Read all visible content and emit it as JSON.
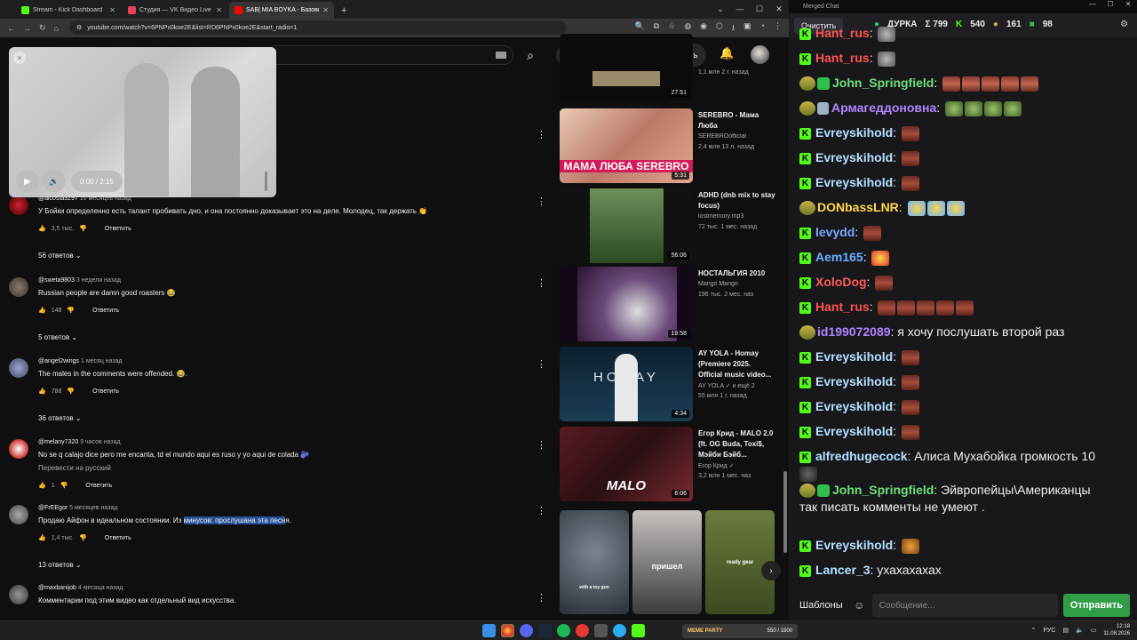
{
  "browser": {
    "tabs": [
      {
        "title": "Stream - Kick Dashboard",
        "color": "#53fc18"
      },
      {
        "title": "Студия — VK Видео Live",
        "color": "#e8415b"
      },
      {
        "title": "SAB| MIA BOYKA - Базовый м",
        "color": "#ff0000"
      }
    ],
    "url": "youtube.com/watch?v=6PNPx0koe2E&list=RD6PNPx0koe2E&start_radio=1",
    "newtab": "+"
  },
  "youtube": {
    "create_label": "Создать",
    "player": {
      "time": "0:00 / 2:15"
    },
    "comments": [
      {
        "author": "@alcosta3297",
        "ago": "10 месяцев назад",
        "text": "У Бойки определенно есть талант пробивать дно, и она постоянно доказывает это на деле. Молодец, так держать 👏",
        "likes": "3,5 тыс.",
        "reply": "Ответить",
        "replies": "56 ответов"
      },
      {
        "author": "@sweta9803",
        "ago": "3 недели назад",
        "text": "Russian people are damn good roasters 😂",
        "likes": "148",
        "reply": "Ответить",
        "replies": "5 ответов"
      },
      {
        "author": "@angel2wings",
        "ago": "1 месяц назад",
        "text": "The males in the comments were offended. 😂.",
        "likes": "788",
        "reply": "Ответить",
        "replies": "36 ответов"
      },
      {
        "author": "@melany7320",
        "ago": "9 часов назад",
        "text": "No se q calajo dice pero me encanta, td el mundo aqui es ruso y yo aqui de colada 🫐",
        "translate": "Перевести на русский",
        "likes": "1",
        "reply": "Ответить"
      },
      {
        "author": "@FrEEgor",
        "ago": "5 месяцев назад",
        "text_a": "Продаю Айфон в идеальном состоянии. Из ",
        "text_b": "минусов: прослушана эта песн",
        "text_c": "я.",
        "likes": "1,4 тыс.",
        "reply": "Ответить",
        "replies": "13 ответов"
      },
      {
        "author": "@maxbanijob",
        "ago": "4 месяца назад",
        "text": "Комментарии под этим видео как отдельный вид искусства."
      }
    ],
    "related": [
      {
        "title": "",
        "channel": "",
        "views": "1,1 млн  2 г. назад",
        "duration": "27:51"
      },
      {
        "title": "SEREBRO - Мама Люба",
        "channel": "SEREBROofficial",
        "views": "2,4 млн  13 л. назад",
        "duration": "5:31",
        "thumb_text": "МАМА ЛЮБА SEREBRO"
      },
      {
        "title": "ADHD (dnb mix to stay focus)",
        "channel": "lostmemory.mp3",
        "views": "72 тыс.  1 мес. назад",
        "duration": "56:06"
      },
      {
        "title": "НОСТАЛЬГИЯ 2010",
        "channel": "Mango Mango",
        "views": "196 тыс.  2 мес. наз",
        "duration": "19:58"
      },
      {
        "title": "AY YOLA - Homay (Premiere 2025. Official music video...",
        "channel": "AY YOLA  ✓ и ещё 2",
        "views": "55 млн  1 г. назад",
        "duration": "4:34",
        "thumb_text": "HOMAY"
      },
      {
        "title": "Егор Крид - MALO 2.0 (ft. OG Buda, Toxi$, Мэйби Бэйб...",
        "channel": "Егор Крид ✓",
        "views": "3,2 млн  1 мес. наз",
        "duration": "6:06",
        "thumb_text": "MALO"
      }
    ],
    "shorts": [
      {
        "caption": "with a toy gun"
      },
      {
        "caption": "пришел"
      },
      {
        "caption": "ready gear"
      }
    ]
  },
  "chat": {
    "window_title": "Merged Chat",
    "clear_label": "Очистить",
    "channel": "ДУРКА",
    "stats": {
      "sigma": "Σ 799",
      "kick": "540",
      "vk": "161",
      "other": "98"
    },
    "messages": [
      {
        "user": "Hant_rus",
        "text": "",
        "color": "#ff5252",
        "src": "kick",
        "emotes": [
          "pot"
        ]
      },
      {
        "user": "Hant_rus",
        "text": "",
        "color": "#ff5252",
        "src": "kick",
        "emotes": [
          "pot"
        ]
      },
      {
        "user": "John_Springfield",
        "text": "",
        "color": "#6fe07a",
        "src": "vk-b",
        "emotes": [
          "face",
          "face",
          "face",
          "face",
          "face"
        ]
      },
      {
        "user": "Армагеддоновна",
        "text": "",
        "color": "#b084ff",
        "src": "vk-s",
        "emotes": [
          "frog",
          "frog",
          "frog",
          "frog"
        ]
      },
      {
        "user": "Evreyskihold",
        "text": "",
        "color": "#b6e0ff",
        "src": "kick",
        "emotes": [
          "meat"
        ]
      },
      {
        "user": "Evreyskihold",
        "text": "",
        "color": "#b6e0ff",
        "src": "kick",
        "emotes": [
          "meat"
        ]
      },
      {
        "user": "Evreyskihold",
        "text": "",
        "color": "#b6e0ff",
        "src": "kick",
        "emotes": [
          "meat"
        ]
      },
      {
        "user": "DONbassLNR",
        "text": "",
        "color": "#ffd84a",
        "src": "vk",
        "emotes": [
          "cry",
          "cry",
          "cry"
        ]
      },
      {
        "user": "levydd",
        "text": "",
        "color": "#7aa7ff",
        "src": "kick",
        "emotes": [
          "meat"
        ]
      },
      {
        "user": "Aem165",
        "text": "",
        "color": "#6ab0ff",
        "src": "kick",
        "emotes": [
          "clown"
        ]
      },
      {
        "user": "XoloDog",
        "text": "",
        "color": "#ff5a5a",
        "src": "kick",
        "emotes": [
          "meat"
        ]
      },
      {
        "user": "Hant_rus",
        "text": "",
        "color": "#ff5252",
        "src": "kick",
        "emotes": [
          "meat",
          "meat",
          "meat",
          "meat",
          "meat"
        ]
      },
      {
        "user": "id199072089",
        "text": "я хочу послушать второй раз",
        "color": "#b084ff",
        "src": "vk",
        "emotes": []
      },
      {
        "user": "Evreyskihold",
        "text": "",
        "color": "#b6e0ff",
        "src": "kick",
        "emotes": [
          "meat"
        ]
      },
      {
        "user": "Evreyskihold",
        "text": "",
        "color": "#b6e0ff",
        "src": "kick",
        "emotes": [
          "meat"
        ]
      },
      {
        "user": "Evreyskihold",
        "text": "",
        "color": "#b6e0ff",
        "src": "kick",
        "emotes": [
          "meat"
        ]
      },
      {
        "user": "Evreyskihold",
        "text": "",
        "color": "#b6e0ff",
        "src": "kick",
        "emotes": [
          "meat"
        ]
      },
      {
        "user": "alfredhugecock",
        "text": "Алиса Мухабойка громкость 10",
        "color": "#b6e0ff",
        "src": "kick",
        "emotes": []
      },
      {
        "user": "John_Springfield",
        "text": "Эйвропейцы\\Американцы",
        "text2": "так писать комменты не умеют .",
        "color": "#6fe07a",
        "src": "vk-b",
        "emotes": []
      },
      {
        "user": "Evreyskihold",
        "text": "",
        "color": "#b6e0ff",
        "src": "kick",
        "emotes": [
          "fox"
        ]
      },
      {
        "user": "Lancer_3",
        "text": "ухахахахах",
        "color": "#b6e0ff",
        "src": "kick",
        "emotes": []
      }
    ],
    "templates_label": "Шаблоны",
    "input_placeholder": "Сообщение...",
    "send_label": "Отправить"
  },
  "taskbar": {
    "app_label": "MEME PARTY",
    "app_progress": "550 / 1500",
    "lang": "РУС",
    "time": "12:18",
    "date": "11.08.2026"
  }
}
